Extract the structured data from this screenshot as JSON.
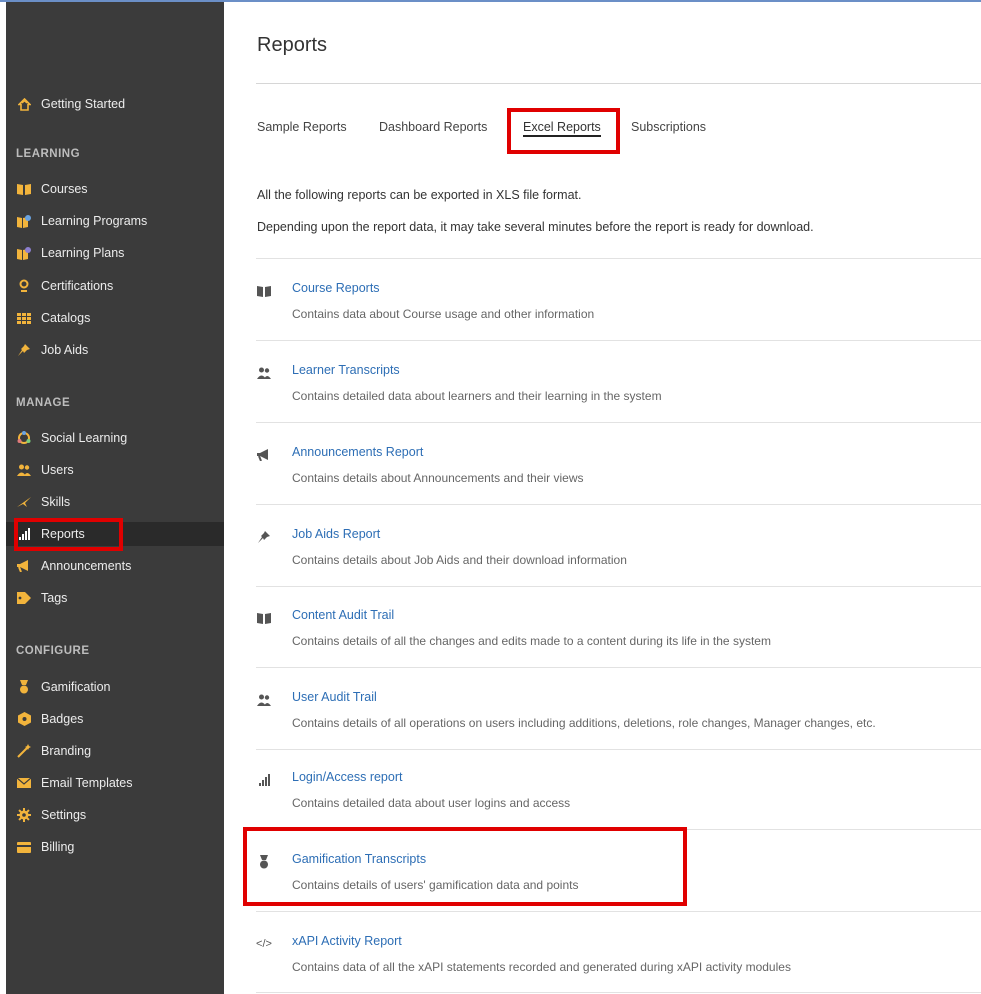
{
  "sidebar": {
    "getting_started": "Getting Started",
    "sections": {
      "learning": "LEARNING",
      "manage": "MANAGE",
      "configure": "CONFIGURE"
    },
    "learning_items": [
      {
        "label": "Courses",
        "icon": "book-icon",
        "color": "#f2b43c"
      },
      {
        "label": "Learning Programs",
        "icon": "learning-programs-icon",
        "color": "#f2b43c"
      },
      {
        "label": "Learning Plans",
        "icon": "learning-plans-icon",
        "color": "#f2b43c"
      },
      {
        "label": "Certifications",
        "icon": "certificate-icon",
        "color": "#f2b43c"
      },
      {
        "label": "Catalogs",
        "icon": "catalog-grid-icon",
        "color": "#f2b43c"
      },
      {
        "label": "Job Aids",
        "icon": "pin-icon",
        "color": "#f2b43c"
      }
    ],
    "manage_items": [
      {
        "label": "Social Learning",
        "icon": "social-icon",
        "color": "#f2b43c"
      },
      {
        "label": "Users",
        "icon": "users-icon",
        "color": "#f2b43c"
      },
      {
        "label": "Skills",
        "icon": "skills-icon",
        "color": "#f2b43c"
      },
      {
        "label": "Reports",
        "icon": "bar-chart-icon",
        "color": "#ffffff"
      },
      {
        "label": "Announcements",
        "icon": "megaphone-icon",
        "color": "#f2b43c"
      },
      {
        "label": "Tags",
        "icon": "tag-icon",
        "color": "#f2b43c"
      }
    ],
    "configure_items": [
      {
        "label": "Gamification",
        "icon": "medal-icon",
        "color": "#f2b43c"
      },
      {
        "label": "Badges",
        "icon": "badge-icon",
        "color": "#f2b43c"
      },
      {
        "label": "Branding",
        "icon": "wand-icon",
        "color": "#f2b43c"
      },
      {
        "label": "Email Templates",
        "icon": "email-icon",
        "color": "#f2b43c"
      },
      {
        "label": "Settings",
        "icon": "gear-icon",
        "color": "#f2b43c"
      },
      {
        "label": "Billing",
        "icon": "billing-icon",
        "color": "#f2b43c"
      }
    ]
  },
  "main": {
    "title": "Reports",
    "tabs": [
      "Sample Reports",
      "Dashboard Reports",
      "Excel Reports",
      "Subscriptions"
    ],
    "active_tab": "Excel Reports",
    "intro_1": "All the following reports can be exported in XLS file format.",
    "intro_2": "Depending upon the report data, it may take several minutes before the report is ready for download.",
    "reports": [
      {
        "title": "Course Reports",
        "desc": "Contains data about Course usage and other information",
        "icon": "book-icon"
      },
      {
        "title": "Learner Transcripts",
        "desc": "Contains detailed data about learners and their learning in the system",
        "icon": "users-icon"
      },
      {
        "title": "Announcements Report",
        "desc": "Contains details about Announcements and their views",
        "icon": "megaphone-icon"
      },
      {
        "title": "Job Aids Report",
        "desc": "Contains details about Job Aids and their download information",
        "icon": "pin-icon"
      },
      {
        "title": "Content Audit Trail",
        "desc": "Contains details of all the changes and edits made to a content during its life in the system",
        "icon": "book-icon"
      },
      {
        "title": "User Audit Trail",
        "desc": "Contains details of all operations on users including additions, deletions, role changes, Manager changes, etc.",
        "icon": "users-icon"
      },
      {
        "title": "Login/Access report",
        "desc": "Contains detailed data about user logins and access",
        "icon": "bar-chart-icon"
      },
      {
        "title": "Gamification Transcripts",
        "desc": "Contains details of users' gamification data and points",
        "icon": "medal-icon"
      },
      {
        "title": "xAPI Activity Report",
        "desc": "Contains data of all the xAPI statements recorded and generated during xAPI activity modules",
        "icon": "xapi-icon"
      }
    ]
  },
  "colors": {
    "sidebar_bg": "#3b3b3b",
    "icon_accent": "#f2b43c",
    "link": "#2d6eb5",
    "highlight": "#e00000"
  }
}
